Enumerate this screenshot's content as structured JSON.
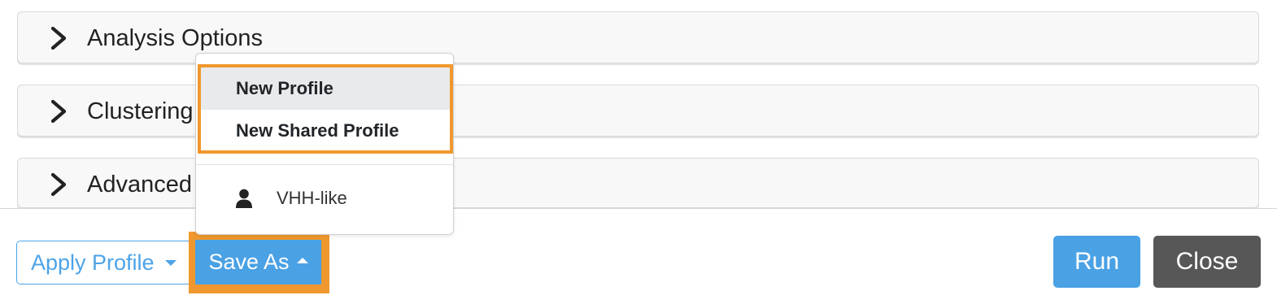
{
  "panels": [
    {
      "title": "Analysis Options"
    },
    {
      "title": "Clustering"
    },
    {
      "title": "Advanced"
    }
  ],
  "footer": {
    "apply_profile_label": "Apply Profile",
    "save_as_label": "Save As",
    "run_label": "Run",
    "close_label": "Close"
  },
  "save_as_menu": {
    "items": [
      {
        "label": "New Profile"
      },
      {
        "label": "New Shared Profile"
      }
    ],
    "profiles": [
      {
        "label": "VHH-like",
        "icon": "user-icon"
      }
    ]
  },
  "colors": {
    "accent": "#4aa1e4",
    "highlight": "#f0982d",
    "close_button": "#575757"
  }
}
